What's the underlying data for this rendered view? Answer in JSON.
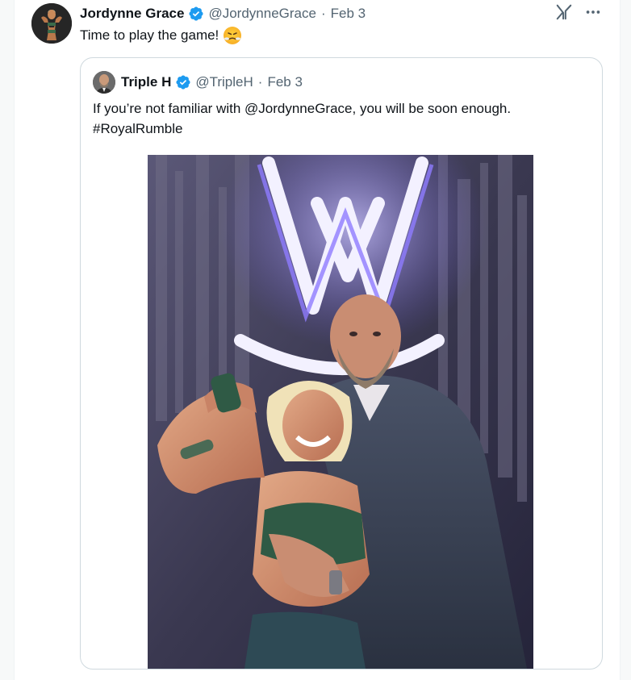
{
  "tweet": {
    "author_name": "Jordynne Grace",
    "author_handle": "@JordynneGrace",
    "separator": "·",
    "date": "Feb 3",
    "text": "Time to play the game!",
    "emoji": "triumph-face-emoji"
  },
  "quoted_tweet": {
    "author_name": "Triple H",
    "author_handle": "@TripleH",
    "separator": "·",
    "date": "Feb 3",
    "text_line1": "If you’re not familiar with @JordynneGrace, you will be soon enough.",
    "text_line2": "#RoyalRumble"
  },
  "icons": {
    "verified": "verified-badge-icon",
    "grok": "grok-icon",
    "more": "more-options-icon"
  },
  "colors": {
    "verified_blue": "#1d9bf0",
    "text_primary": "#0f1419",
    "text_secondary": "#536471",
    "border": "#cfd9de"
  }
}
